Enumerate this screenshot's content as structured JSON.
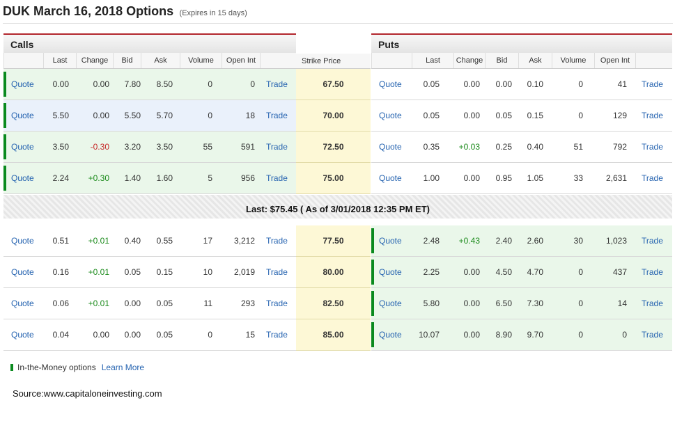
{
  "title": "DUK March 16, 2018 Options",
  "expires": "(Expires in 15 days)",
  "calls_label": "Calls",
  "puts_label": "Puts",
  "strike_header": "Strike Price",
  "columns": [
    "Last",
    "Change",
    "Bid",
    "Ask",
    "Volume",
    "Open Int"
  ],
  "quote_label": "Quote",
  "trade_label": "Trade",
  "last_banner": "Last: $75.45 ( As of 3/01/2018 12:35 PM ET)",
  "rows": [
    {
      "strike": "67.50",
      "call": {
        "last": "0.00",
        "change": "0.00",
        "bid": "7.80",
        "ask": "8.50",
        "volume": "0",
        "oi": "0"
      },
      "put": {
        "last": "0.05",
        "change": "0.00",
        "bid": "0.00",
        "ask": "0.10",
        "volume": "0",
        "oi": "41"
      }
    },
    {
      "strike": "70.00",
      "call": {
        "last": "5.50",
        "change": "0.00",
        "bid": "5.50",
        "ask": "5.70",
        "volume": "0",
        "oi": "18"
      },
      "put": {
        "last": "0.05",
        "change": "0.00",
        "bid": "0.05",
        "ask": "0.15",
        "volume": "0",
        "oi": "129"
      }
    },
    {
      "strike": "72.50",
      "call": {
        "last": "3.50",
        "change": "-0.30",
        "bid": "3.20",
        "ask": "3.50",
        "volume": "55",
        "oi": "591"
      },
      "put": {
        "last": "0.35",
        "change": "+0.03",
        "bid": "0.25",
        "ask": "0.40",
        "volume": "51",
        "oi": "792"
      }
    },
    {
      "strike": "75.00",
      "call": {
        "last": "2.24",
        "change": "+0.30",
        "bid": "1.40",
        "ask": "1.60",
        "volume": "5",
        "oi": "956"
      },
      "put": {
        "last": "1.00",
        "change": "0.00",
        "bid": "0.95",
        "ask": "1.05",
        "volume": "33",
        "oi": "2,631"
      }
    },
    {
      "strike": "77.50",
      "call": {
        "last": "0.51",
        "change": "+0.01",
        "bid": "0.40",
        "ask": "0.55",
        "volume": "17",
        "oi": "3,212"
      },
      "put": {
        "last": "2.48",
        "change": "+0.43",
        "bid": "2.40",
        "ask": "2.60",
        "volume": "30",
        "oi": "1,023"
      }
    },
    {
      "strike": "80.00",
      "call": {
        "last": "0.16",
        "change": "+0.01",
        "bid": "0.05",
        "ask": "0.15",
        "volume": "10",
        "oi": "2,019"
      },
      "put": {
        "last": "2.25",
        "change": "0.00",
        "bid": "4.50",
        "ask": "4.70",
        "volume": "0",
        "oi": "437"
      }
    },
    {
      "strike": "82.50",
      "call": {
        "last": "0.06",
        "change": "+0.01",
        "bid": "0.00",
        "ask": "0.05",
        "volume": "11",
        "oi": "293"
      },
      "put": {
        "last": "5.80",
        "change": "0.00",
        "bid": "6.50",
        "ask": "7.30",
        "volume": "0",
        "oi": "14"
      }
    },
    {
      "strike": "85.00",
      "call": {
        "last": "0.04",
        "change": "0.00",
        "bid": "0.00",
        "ask": "0.05",
        "volume": "0",
        "oi": "15"
      },
      "put": {
        "last": "10.07",
        "change": "0.00",
        "bid": "8.90",
        "ask": "9.70",
        "volume": "0",
        "oi": "0"
      }
    }
  ],
  "legend_text": "In-the-Money options",
  "learn_more": "Learn More",
  "source": "Source:www.capitaloneinvesting.com",
  "colors": {
    "itm_bar": "#0a8a1e",
    "itm_bg": "#eaf7ea",
    "link": "#2563b0",
    "header_rule": "#b2262c",
    "strike_bg": "#fdf8d6"
  }
}
